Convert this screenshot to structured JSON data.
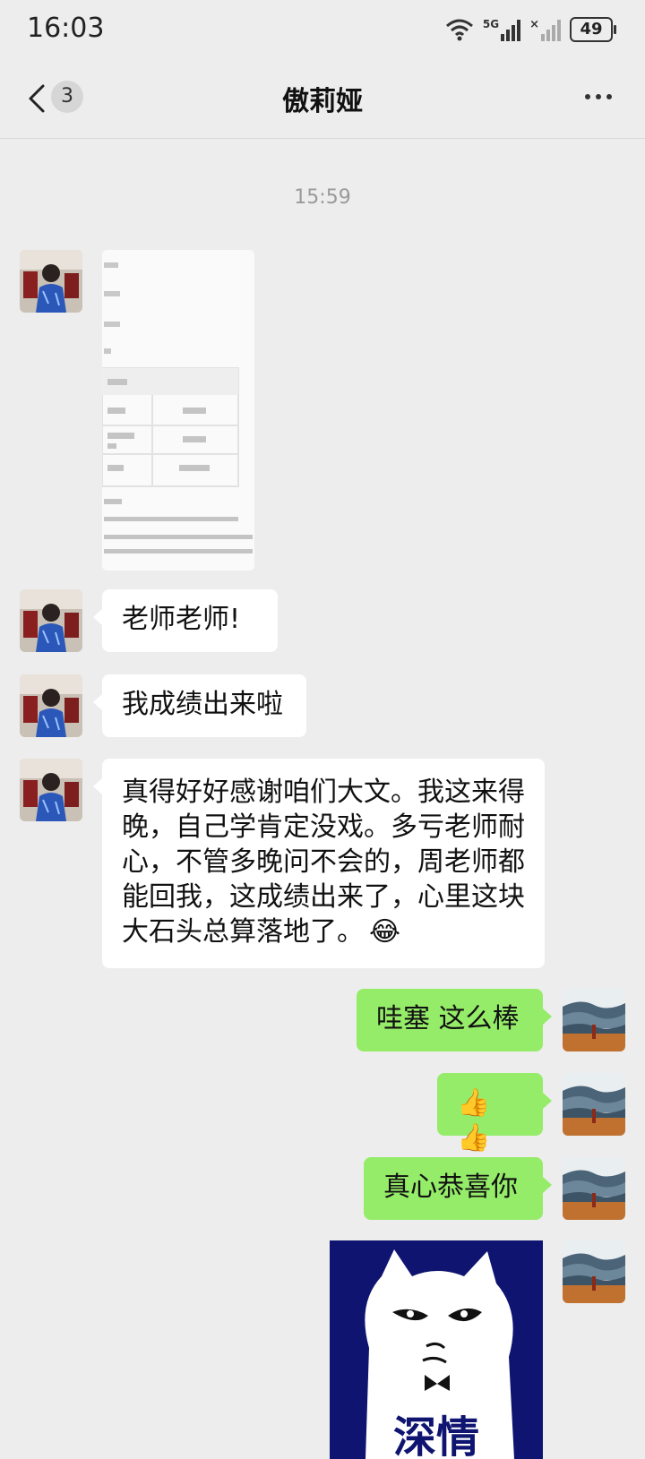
{
  "status": {
    "time": "16:03",
    "network": "5G",
    "battery": "49"
  },
  "nav": {
    "unread_count": "3",
    "title": "傲莉娅"
  },
  "chat": {
    "timestamp": "15:59",
    "messages": [
      {
        "side": "left",
        "type": "image"
      },
      {
        "side": "left",
        "type": "text",
        "text": "老师老师!"
      },
      {
        "side": "left",
        "type": "text",
        "text": "我成绩出来啦"
      },
      {
        "side": "left",
        "type": "text",
        "lines": [
          "真得好好感谢咱们大文。我这来得",
          "晚，自己学肯定没戏。多亏老师耐",
          "心，不管多晚问不会的，周老师都",
          "能回我，这成绩出来了，心里这块",
          "大石头总算落地了。"
        ],
        "emoji": "😂"
      },
      {
        "side": "right",
        "type": "text",
        "text": "哇塞 这么棒"
      },
      {
        "side": "right",
        "type": "text",
        "text": "👍👍"
      },
      {
        "side": "right",
        "type": "text",
        "text": "真心恭喜你"
      },
      {
        "side": "right",
        "type": "sticker",
        "caption": "深情"
      }
    ]
  },
  "colors": {
    "background": "#ededed",
    "incoming_bubble": "#ffffff",
    "outgoing_bubble": "#95ec69",
    "sticker_bg": "#0e1470"
  }
}
